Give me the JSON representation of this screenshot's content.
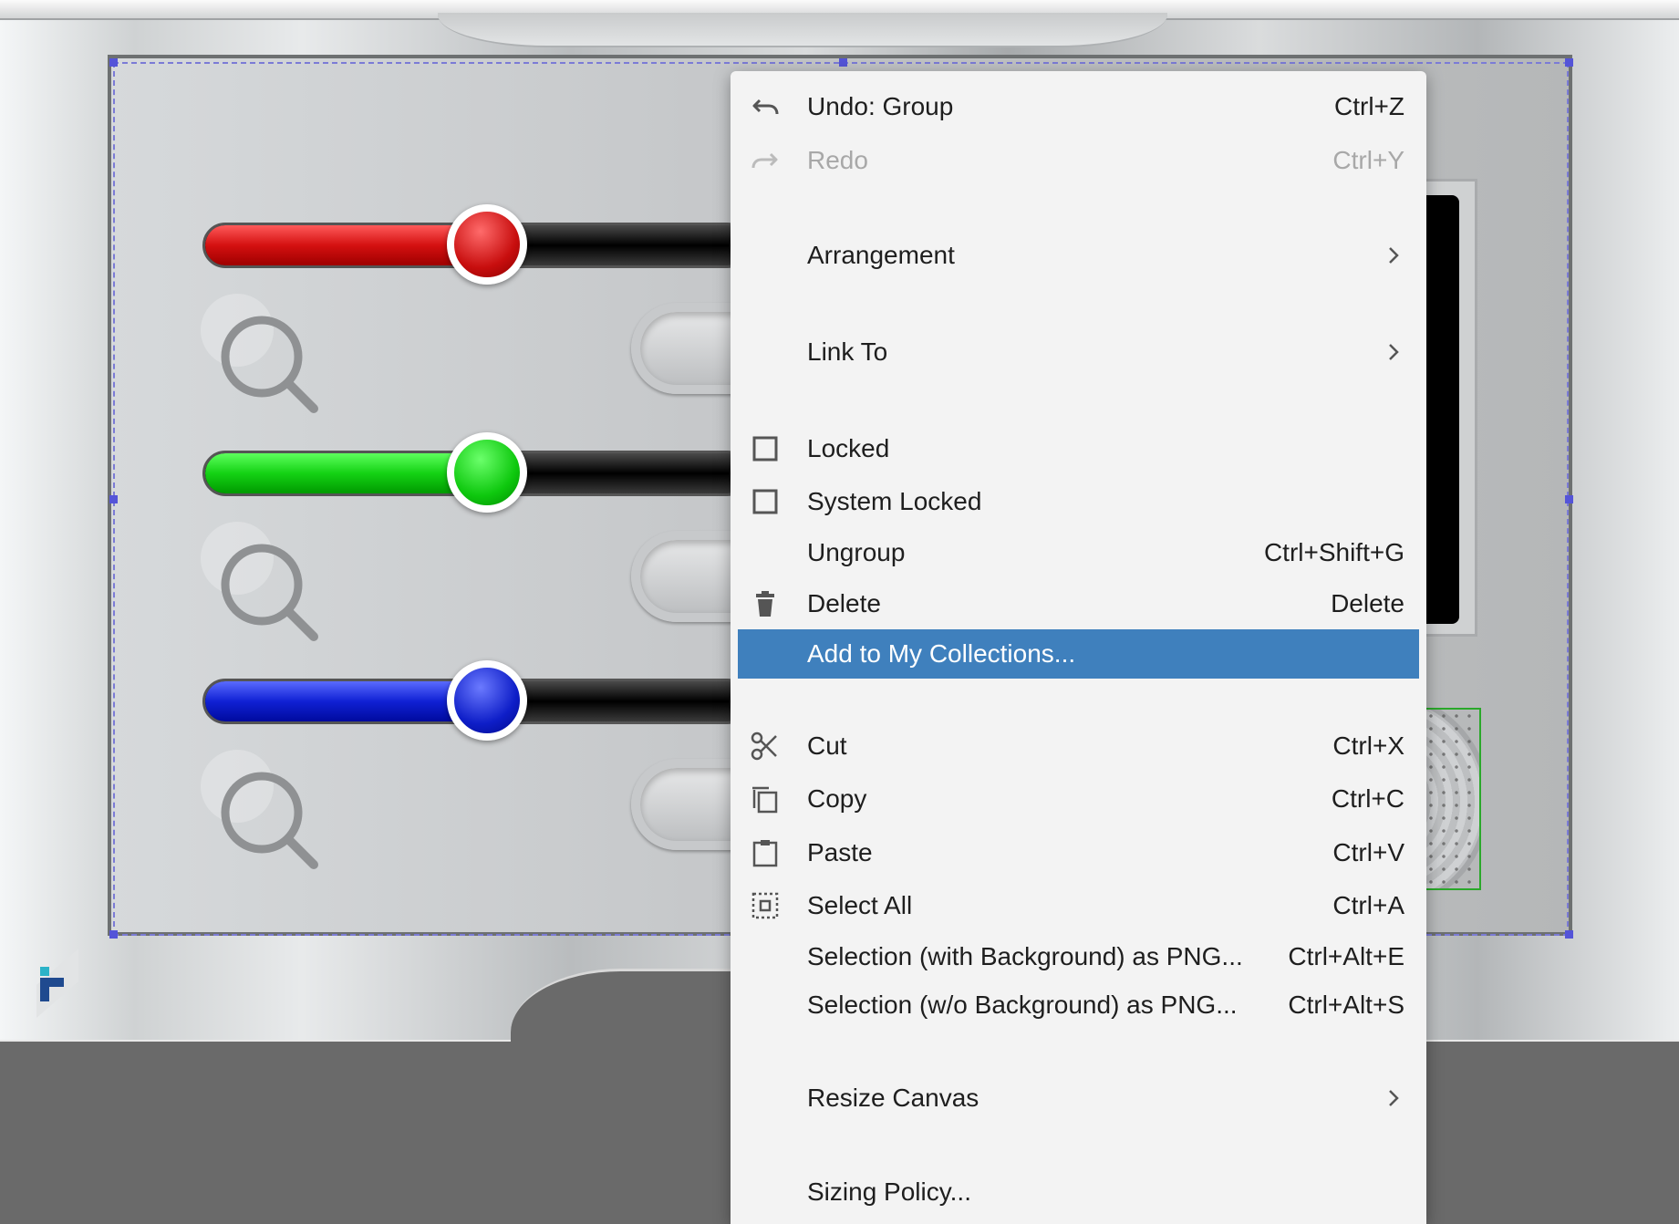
{
  "canvas": {
    "sliders": [
      {
        "name": "red",
        "value_percent": 52,
        "color": "#d41010"
      },
      {
        "name": "green",
        "value_percent": 52,
        "color": "#14d214"
      },
      {
        "name": "blue",
        "value_percent": 52,
        "color": "#1021d4"
      }
    ]
  },
  "context_menu": {
    "highlight_color": "#3f80bd",
    "items": [
      {
        "label": "Undo: Group",
        "shortcut": "Ctrl+Z",
        "icon": "undo-icon"
      },
      {
        "label": "Redo",
        "shortcut": "Ctrl+Y",
        "icon": "redo-icon",
        "disabled": true
      },
      {
        "label": "Arrangement",
        "icon": "chevron-right-icon"
      },
      {
        "label": "Link To",
        "icon": "chevron-right-icon"
      },
      {
        "label": "Locked",
        "icon": "checkbox-icon",
        "checked": false
      },
      {
        "label": "System Locked",
        "icon": "checkbox-icon",
        "checked": false
      },
      {
        "label": "Ungroup",
        "shortcut": "Ctrl+Shift+G"
      },
      {
        "label": "Delete",
        "shortcut": "Delete",
        "icon": "trash-icon"
      },
      {
        "label": "Add to My Collections...",
        "highlighted": true
      },
      {
        "label": "Cut",
        "shortcut": "Ctrl+X",
        "icon": "scissors-icon"
      },
      {
        "label": "Copy",
        "shortcut": "Ctrl+C",
        "icon": "copy-icon"
      },
      {
        "label": "Paste",
        "shortcut": "Ctrl+V",
        "icon": "clipboard-icon"
      },
      {
        "label": "Select All",
        "shortcut": "Ctrl+A",
        "icon": "select-all-icon"
      },
      {
        "label": "Selection (with Background) as PNG...",
        "shortcut": "Ctrl+Alt+E"
      },
      {
        "label": "Selection (w/o Background) as PNG...",
        "shortcut": "Ctrl+Alt+S"
      },
      {
        "label": "Resize Canvas",
        "icon": "chevron-right-icon"
      },
      {
        "label": "Sizing Policy..."
      }
    ]
  }
}
